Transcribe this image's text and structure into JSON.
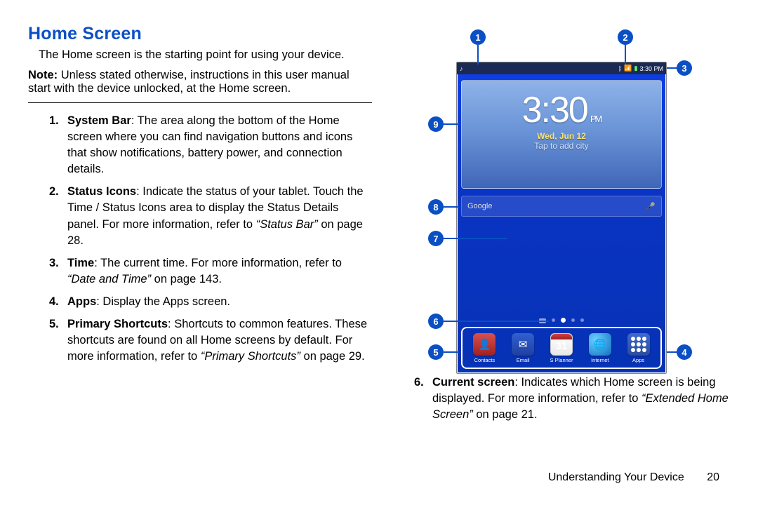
{
  "heading": "Home Screen",
  "intro": "The Home screen is the starting point for using your device.",
  "note_label": "Note:",
  "note_body": " Unless stated otherwise, instructions in this user manual start with the device unlocked, at the Home screen.",
  "items": [
    {
      "n": "1.",
      "lead": "System Bar",
      "tail": ": The area along the bottom of the Home screen where you can find navigation buttons and icons that show notifications, battery power, and connection details."
    },
    {
      "n": "2.",
      "lead": "Status Icons",
      "tail": ": Indicate the status of your tablet. Touch the Time / Status Icons area to display the Status Details panel. For more information, refer to ",
      "ref": "“Status Bar”",
      "after": " on page 28."
    },
    {
      "n": "3.",
      "lead": "Time",
      "tail": ": The current time. For more information, refer to ",
      "ref": "“Date and Time”",
      "after": " on page 143."
    },
    {
      "n": "4.",
      "lead": "Apps",
      "tail": ": Display the Apps screen."
    },
    {
      "n": "5.",
      "lead": "Primary Shortcuts",
      "tail": ": Shortcuts to common features. These shortcuts are found on all Home screens by default. For more information, refer to ",
      "ref": "“Primary Shortcuts”",
      "after": " on page 29."
    }
  ],
  "item6": {
    "n": "6.",
    "lead": "Current screen",
    "tail": ": Indicates which Home screen is being displayed. For more information, refer to ",
    "ref": "“Extended Home Screen”",
    "after": " on page 21."
  },
  "device": {
    "status_time": "3:30 PM",
    "clock_time": "3:30",
    "clock_ampm": "PM",
    "clock_date": "Wed, Jun 12",
    "clock_tap": "Tap to add city",
    "search_placeholder": "Google",
    "dock": {
      "contacts": "Contacts",
      "email": "Email",
      "splanner": "S Planner",
      "planner_day": "31",
      "internet": "Internet",
      "apps": "Apps"
    }
  },
  "callouts": {
    "c1": "1",
    "c2": "2",
    "c3": "3",
    "c4": "4",
    "c5": "5",
    "c6": "6",
    "c7": "7",
    "c8": "8",
    "c9": "9"
  },
  "footer_chapter": "Understanding Your Device",
  "footer_page": "20"
}
